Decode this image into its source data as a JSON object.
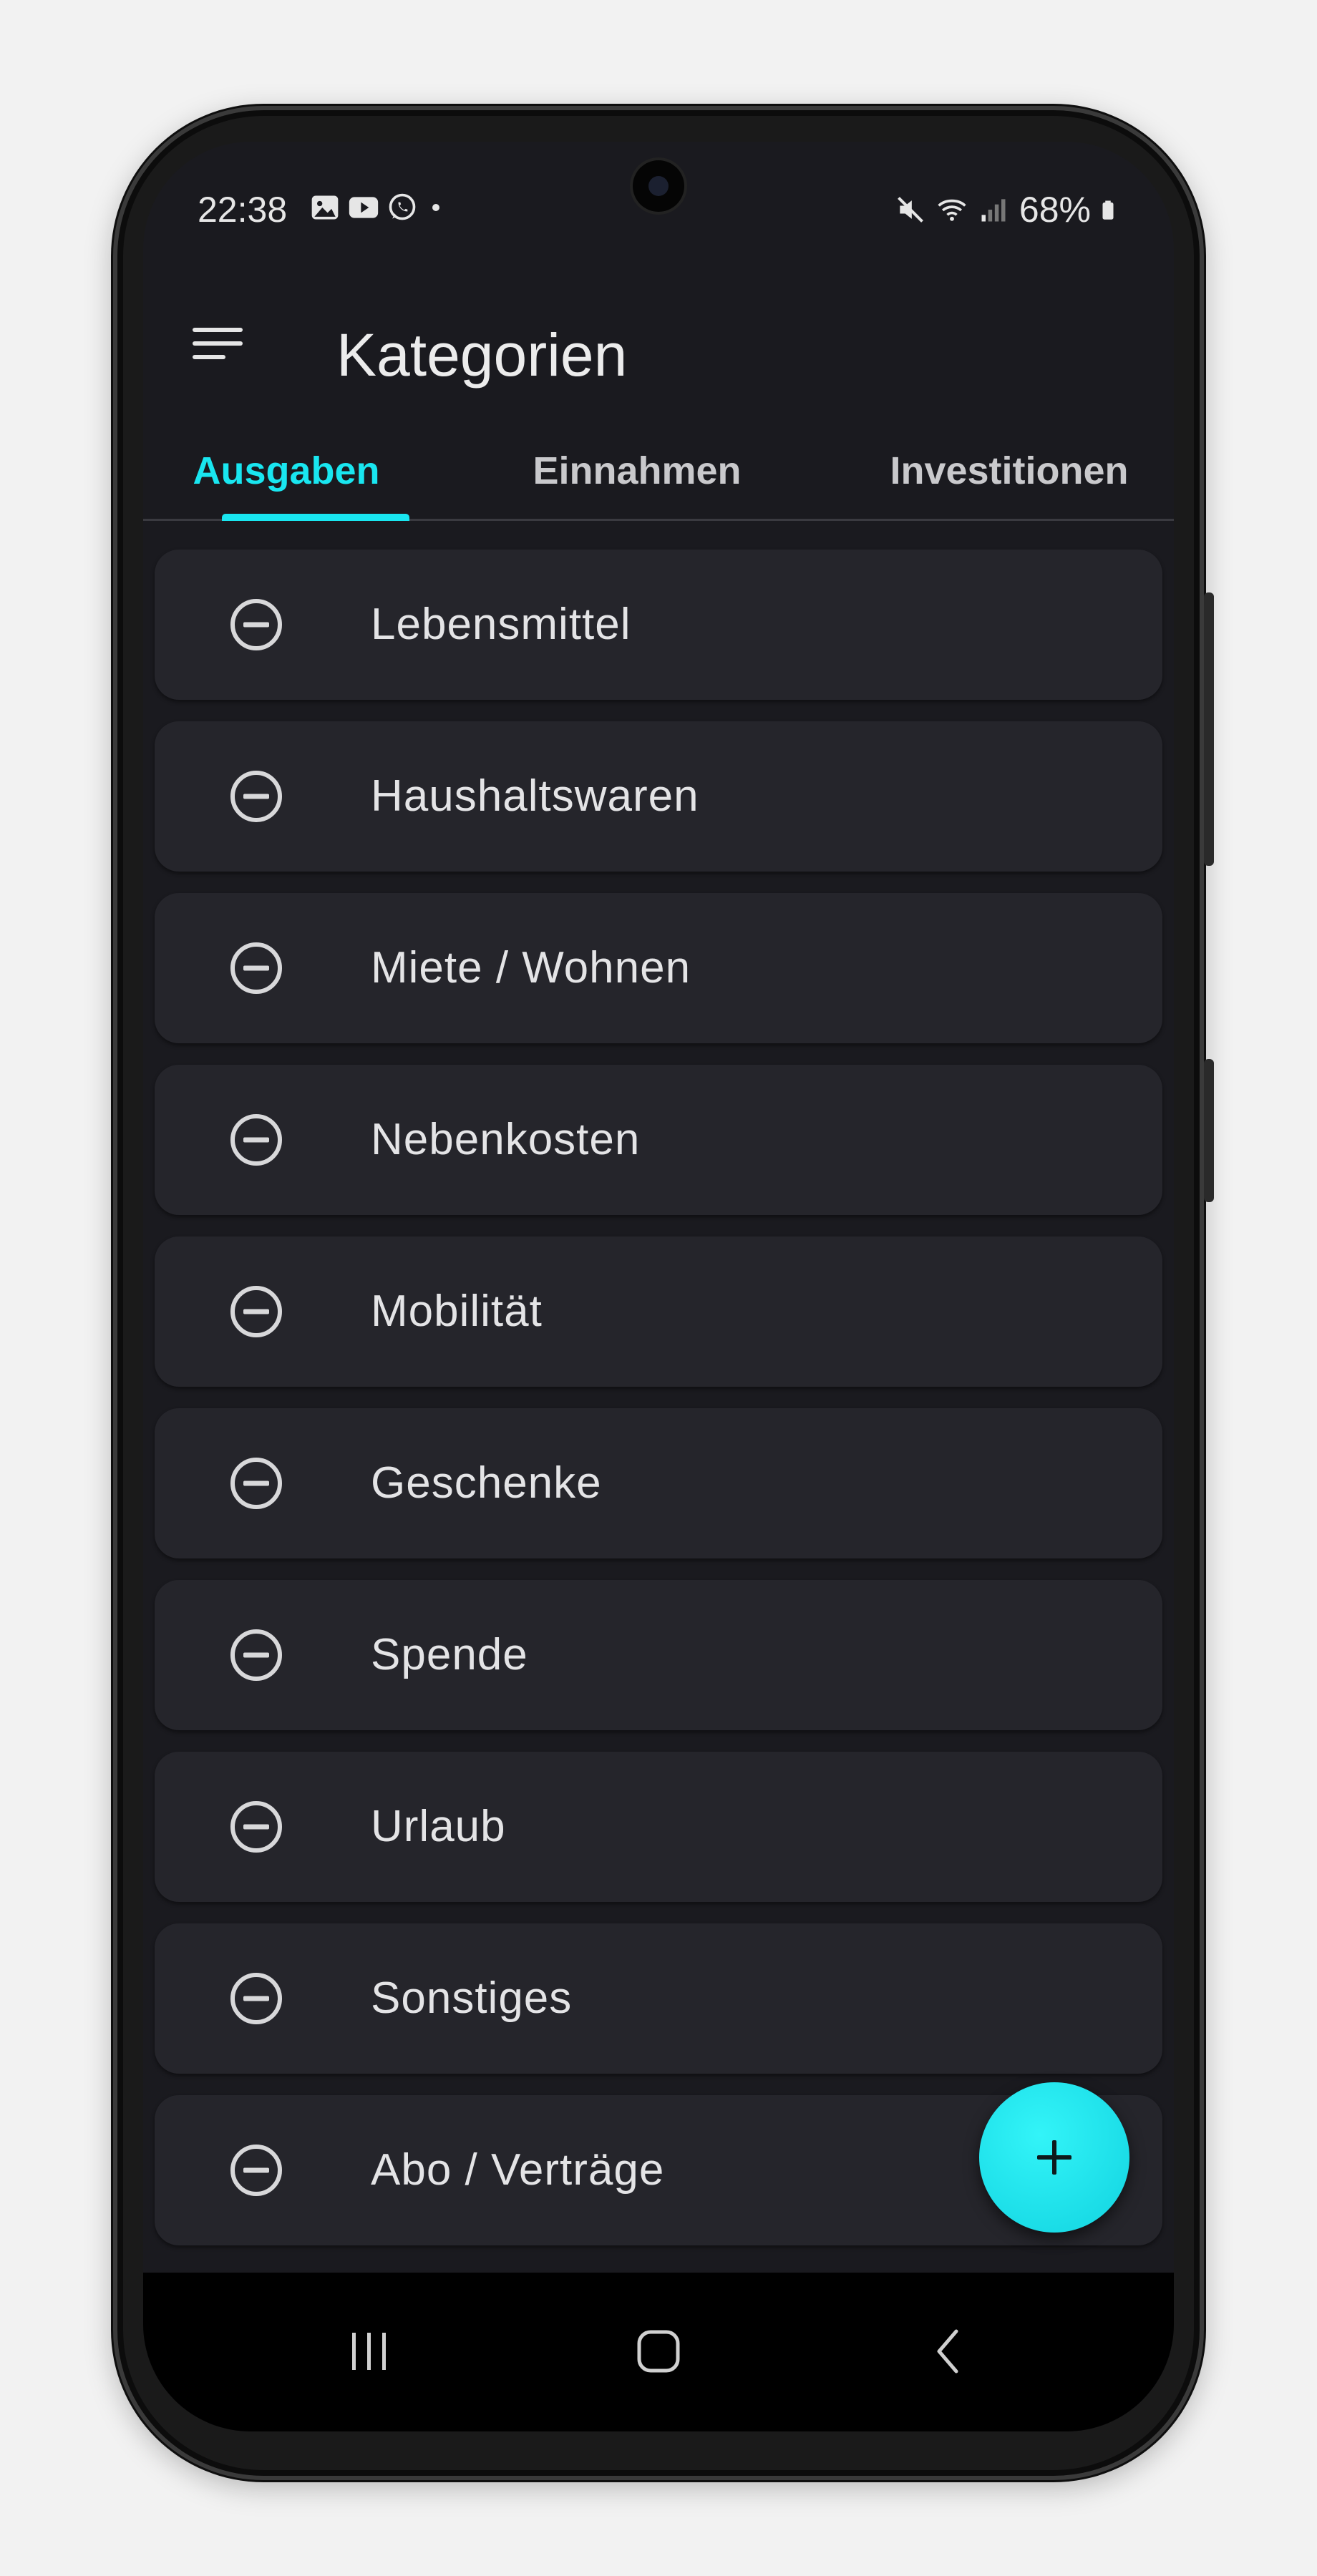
{
  "status_bar": {
    "time": "22:38",
    "battery_text": "68%",
    "left_icons": [
      "gallery-icon",
      "youtube-icon",
      "whatsapp-icon",
      "dot-icon"
    ],
    "right_icons": [
      "mute-icon",
      "wifi-icon",
      "signal-icon",
      "battery-icon"
    ]
  },
  "app_bar": {
    "title": "Kategorien",
    "menu_icon": "menu-icon"
  },
  "tabs": [
    {
      "label": "Ausgaben",
      "active": true
    },
    {
      "label": "Einnahmen",
      "active": false
    },
    {
      "label": "Investitionen",
      "active": false
    }
  ],
  "categories": [
    {
      "label": "Lebensmittel",
      "icon": "remove-circle-icon"
    },
    {
      "label": "Haushaltswaren",
      "icon": "remove-circle-icon"
    },
    {
      "label": "Miete / Wohnen",
      "icon": "remove-circle-icon"
    },
    {
      "label": "Nebenkosten",
      "icon": "remove-circle-icon"
    },
    {
      "label": "Mobilität",
      "icon": "remove-circle-icon"
    },
    {
      "label": "Geschenke",
      "icon": "remove-circle-icon"
    },
    {
      "label": "Spende",
      "icon": "remove-circle-icon"
    },
    {
      "label": "Urlaub",
      "icon": "remove-circle-icon"
    },
    {
      "label": "Sonstiges",
      "icon": "remove-circle-icon"
    },
    {
      "label": "Abo / Verträge",
      "icon": "remove-circle-icon"
    }
  ],
  "fab": {
    "icon": "plus-icon"
  },
  "nav_bar": {
    "icons": [
      "recents-icon",
      "home-icon",
      "back-icon"
    ]
  },
  "colors": {
    "accent": "#19e6f0",
    "background": "#1a1a1f",
    "card": "#25252b",
    "text": "#e4e4e6"
  }
}
